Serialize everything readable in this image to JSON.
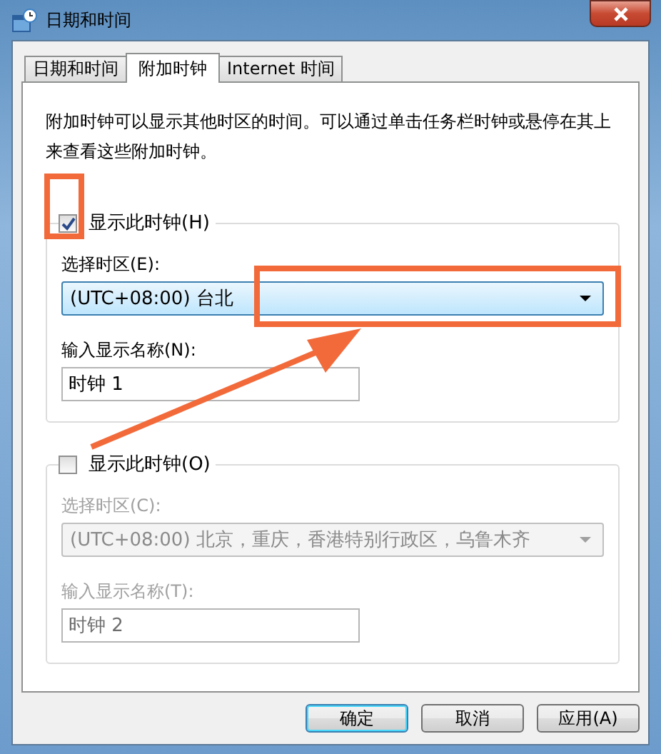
{
  "window": {
    "title": "日期和时间"
  },
  "tabs": [
    {
      "label": "日期和时间",
      "selected": false
    },
    {
      "label": "附加时钟",
      "selected": true
    },
    {
      "label": "Internet 时间",
      "selected": false
    }
  ],
  "description": "附加时钟可以显示其他时区的时间。可以通过单击任务栏时钟或悬停在其上来查看这些附加时钟。",
  "clocks": [
    {
      "show_label": "显示此时钟(H)",
      "checked": true,
      "timezone_label": "选择时区(E):",
      "timezone": "(UTC+08:00) 台北",
      "name_label": "输入显示名称(N):",
      "name": "时钟 1"
    },
    {
      "show_label": "显示此时钟(O)",
      "checked": false,
      "timezone_label": "选择时区(C):",
      "timezone": "(UTC+08:00) 北京，重庆，香港特别行政区，乌鲁木齐",
      "name_label": "输入显示名称(T):",
      "name": "时钟 2"
    }
  ],
  "buttons": [
    {
      "label": "确定",
      "default": true
    },
    {
      "label": "取消",
      "default": false
    },
    {
      "label": "应用(A)",
      "default": false
    }
  ]
}
